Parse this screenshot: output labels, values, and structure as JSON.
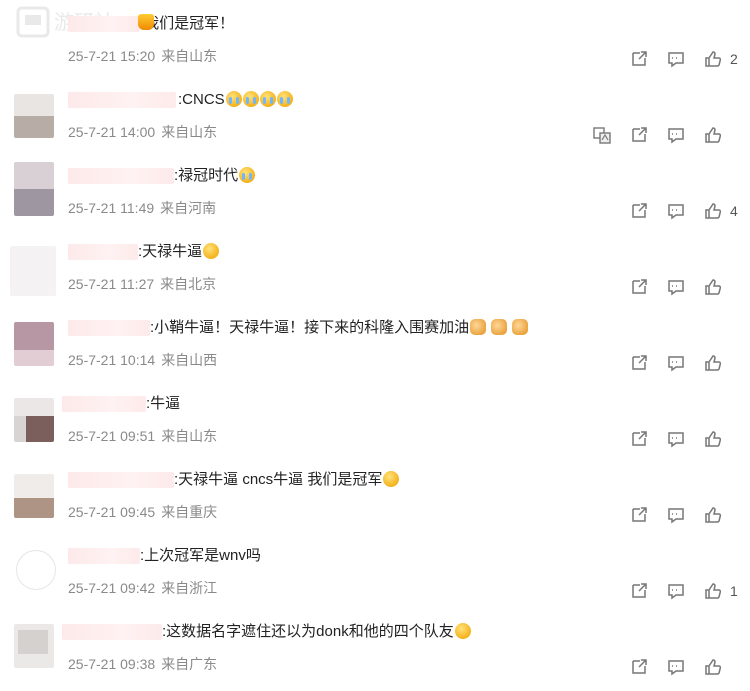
{
  "watermark": {
    "text": "游研社"
  },
  "comments": [
    {
      "text": ":我们是冠军！",
      "emoji": [
        "trophy"
      ],
      "date": "25-7-21 15:20",
      "location": "来自山东",
      "likes": "2",
      "translate": false
    },
    {
      "text": ":CNCS",
      "emoji": [
        "cry",
        "cry",
        "cry",
        "cry"
      ],
      "date": "25-7-21 14:00",
      "location": "来自山东",
      "likes": "",
      "translate": true
    },
    {
      "text": ":禄冠时代",
      "emoji": [
        "cry"
      ],
      "date": "25-7-21 11:49",
      "location": "来自河南",
      "likes": "4",
      "translate": false
    },
    {
      "text": ":天禄牛逼",
      "emoji": [
        "cry"
      ],
      "date": "25-7-21 11:27",
      "location": "来自北京",
      "likes": "",
      "translate": false
    },
    {
      "text": ":小鞘牛逼！天禄牛逼！接下来的科隆入围赛加油",
      "emoji": [
        "fist",
        "fist",
        "fist"
      ],
      "date": "25-7-21 10:14",
      "location": "来自山西",
      "likes": "",
      "translate": false
    },
    {
      "text": ":牛逼",
      "emoji": [],
      "date": "25-7-21 09:51",
      "location": "来自山东",
      "likes": "",
      "translate": false
    },
    {
      "text": ":天禄牛逼 cncs牛逼 我们是冠军",
      "emoji": [
        "trophy"
      ],
      "date": "25-7-21 09:45",
      "location": "来自重庆",
      "likes": "",
      "translate": false
    },
    {
      "text": ":上次冠军是wnv吗",
      "emoji": [],
      "date": "25-7-21 09:42",
      "location": "来自浙江",
      "likes": "1",
      "translate": false
    },
    {
      "text": ":这数据名字遮住还以为donk和他的四个队友",
      "emoji": [
        "cry"
      ],
      "date": "25-7-21 09:38",
      "location": "来自广东",
      "likes": "",
      "translate": false
    }
  ],
  "icons": {
    "translate": "translate-icon",
    "share": "share-icon",
    "comment": "comment-icon",
    "like": "thumbs-up-icon"
  }
}
